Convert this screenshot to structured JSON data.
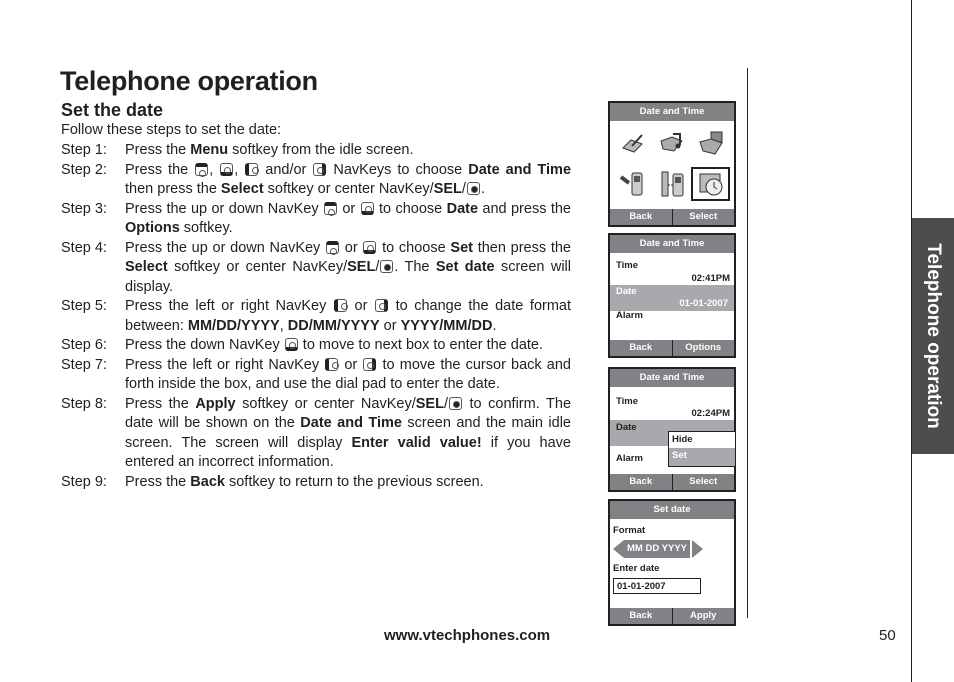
{
  "header": {
    "title": "Telephone operation"
  },
  "section": {
    "title": "Set the date",
    "intro": "Follow these steps to set the date:"
  },
  "steps": [
    {
      "label": "Step 1:",
      "parts": [
        "Press the ",
        "Menu",
        " softkey from the idle screen."
      ]
    },
    {
      "label": "Step 2:",
      "parts": [
        "Press the ",
        "[up]",
        ", ",
        "[down]",
        ", ",
        "[left]",
        " and/or ",
        "[right]",
        " NavKeys to choose ",
        "Date and Time",
        " then press the ",
        "Select",
        " softkey or center NavKey/",
        "SEL",
        "/",
        "[center]",
        "."
      ]
    },
    {
      "label": "Step 3:",
      "parts": [
        "Press the up or down NavKey ",
        "[up]",
        " or ",
        "[down]",
        " to choose ",
        "Date",
        " and press the ",
        "Options",
        " softkey."
      ]
    },
    {
      "label": "Step 4:",
      "parts": [
        "Press the up or down NavKey ",
        "[up]",
        " or ",
        "[down]",
        " to choose ",
        "Set",
        " then press the ",
        "Select",
        " softkey or center NavKey/",
        "SEL",
        "/",
        "[center]",
        ". The ",
        "Set date",
        " screen will display."
      ]
    },
    {
      "label": "Step 5:",
      "parts": [
        "Press the left or right NavKey ",
        "[left]",
        " or ",
        "[right]",
        " to change the date format between: ",
        "MM/DD/YYYY",
        ", ",
        "DD/MM/YYYY",
        " or ",
        "YYYY/MM/DD",
        "."
      ]
    },
    {
      "label": "Step 6:",
      "parts": [
        "Press the down NavKey ",
        "[down]",
        " to move to next box to enter the date."
      ]
    },
    {
      "label": "Step 7:",
      "parts": [
        "Press the left or right NavKey ",
        "[left]",
        " or ",
        "[right]",
        " to move the cursor back and forth inside the box, and use the dial pad to enter the date."
      ]
    },
    {
      "label": "Step 8:",
      "parts": [
        "Press the ",
        "Apply",
        " softkey or center NavKey/",
        "SEL",
        "/",
        "[center]",
        " to confirm.  The date will be shown on the ",
        "Date and Time",
        " screen and the main idle screen. The screen will display ",
        "Enter valid value!",
        " if you have entered an incorrect information."
      ]
    },
    {
      "label": "Step 9:",
      "parts": [
        "Press the ",
        "Back",
        " softkey to return to the previous screen."
      ]
    }
  ],
  "bold_terms": [
    "Menu",
    "Date and Time",
    "Select",
    "SEL",
    "Date",
    "Options",
    "Set",
    "Set date",
    "MM/DD/YYYY",
    "DD/MM/YYYY",
    "YYYY/MM/DD",
    "Apply",
    "Enter valid value!",
    "Back"
  ],
  "screens": {
    "menu": {
      "title": "Date and Time",
      "icons": [
        "memo-icon",
        "ringtone-folder-icon",
        "picture-folder-icon",
        "handset-settings-icon",
        "base-handset-icon",
        "clock-calendar-icon"
      ],
      "selected_icon": 5,
      "left_softkey": "Back",
      "right_softkey": "Select"
    },
    "date_time": {
      "title": "Date and Time",
      "time_label": "Time",
      "time_value": "02:41PM",
      "date_label": "Date",
      "date_value": "01-01-2007",
      "alarm_label": "Alarm",
      "left_softkey": "Back",
      "right_softkey": "Options"
    },
    "options": {
      "title": "Date and Time",
      "time_label": "Time",
      "time_value": "02:24PM",
      "date_label": "Date",
      "alarm_label": "Alarm",
      "menu_items": [
        "Hide",
        "Set"
      ],
      "selected_item": "Set",
      "left_softkey": "Back",
      "right_softkey": "Select"
    },
    "set_date": {
      "title": "Set date",
      "format_label": "Format",
      "format_value": "MM DD YYYY",
      "enter_label": "Enter date",
      "date_value": "01-01-2007",
      "left_softkey": "Back",
      "right_softkey": "Apply"
    }
  },
  "side_tab": {
    "label": "Telephone operation"
  },
  "footer": {
    "url": "www.vtechphones.com",
    "page_number": "50"
  }
}
